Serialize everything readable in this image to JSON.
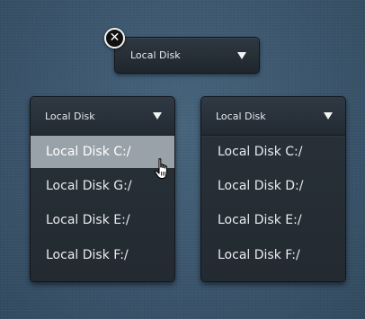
{
  "top_dropdown": {
    "label": "Local Disk",
    "close_glyph": "✕"
  },
  "left_dropdown": {
    "label": "Local Disk",
    "options": [
      "Local Disk C:/",
      "Local Disk G:/",
      "Local Disk E:/",
      "Local Disk F:/"
    ],
    "highlighted_index": 0
  },
  "right_dropdown": {
    "label": "Local Disk",
    "options": [
      "Local Disk C:/",
      "Local Disk D:/",
      "Local Disk E:/",
      "Local Disk F:/"
    ]
  },
  "colors": {
    "background": "#3d5870",
    "panel": "#252c33",
    "highlight": "#9aa2a9",
    "text": "#e8ecef"
  },
  "icons": {
    "close": "close-icon",
    "caret": "caret-down-icon",
    "cursor": "hand-pointer-cursor-icon"
  }
}
